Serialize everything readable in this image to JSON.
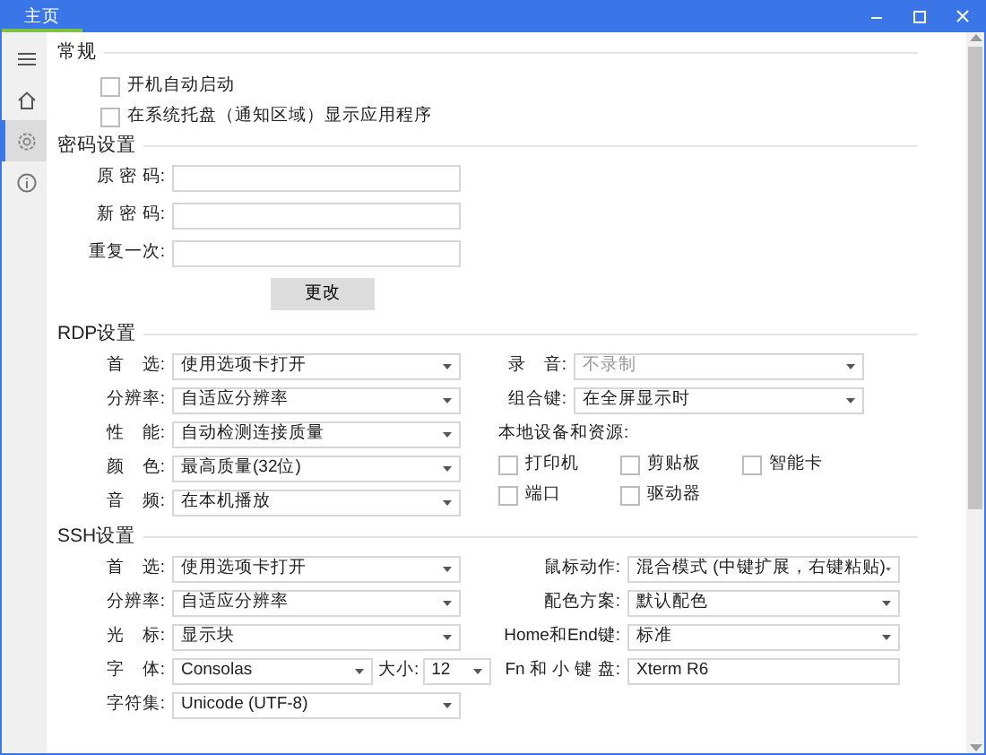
{
  "window": {
    "tab": "主页"
  },
  "sidebar": {
    "items": [
      {
        "kind": "menu",
        "selected": false
      },
      {
        "kind": "home",
        "selected": false
      },
      {
        "kind": "settings",
        "selected": true
      },
      {
        "kind": "info",
        "selected": false
      }
    ]
  },
  "general": {
    "title": "常规",
    "options": [
      {
        "label": "开机自动启动",
        "checked": false
      },
      {
        "label": "在系统托盘（通知区域）显示应用程序",
        "checked": false
      }
    ]
  },
  "password": {
    "title": "密码设置",
    "fields": [
      {
        "label": "原 密 码:"
      },
      {
        "label": "新 密 码:"
      },
      {
        "label": "重复一次:"
      }
    ],
    "button": "更改"
  },
  "rdp": {
    "title": "RDP设置",
    "left": [
      {
        "kind": "dropdown",
        "label": "首　选:",
        "value": "使用选项卡打开",
        "disabled": false
      },
      {
        "kind": "dropdown",
        "label": "分辨率:",
        "value": "自适应分辨率",
        "disabled": false
      },
      {
        "kind": "dropdown",
        "label": "性　能:",
        "value": "自动检测连接质量",
        "disabled": false
      },
      {
        "kind": "dropdown",
        "label": "颜　色:",
        "value": "最高质量(32位)",
        "disabled": false
      },
      {
        "kind": "dropdown",
        "label": "音　频:",
        "value": "在本机播放",
        "disabled": false
      }
    ],
    "right": [
      {
        "kind": "dropdown",
        "label": "录　音:",
        "value": "不录制",
        "disabled": true
      },
      {
        "kind": "dropdown",
        "label": "组合键:",
        "value": "在全屏显示时",
        "disabled": false
      }
    ],
    "resources_label": "本地设备和资源:",
    "resources": [
      {
        "label": "打印机",
        "checked": false
      },
      {
        "label": "剪贴板",
        "checked": false
      },
      {
        "label": "智能卡",
        "checked": false
      },
      {
        "label": "端口",
        "checked": false
      },
      {
        "label": "驱动器",
        "checked": false
      }
    ]
  },
  "ssh": {
    "title": "SSH设置",
    "left": [
      {
        "kind": "dropdown",
        "label": "首　选:",
        "value": "使用选项卡打开",
        "disabled": false
      },
      {
        "kind": "dropdown",
        "label": "分辨率:",
        "value": "自适应分辨率",
        "disabled": false
      },
      {
        "kind": "dropdown",
        "label": "光　标:",
        "value": "显示块",
        "disabled": false
      },
      {
        "kind": "font",
        "label": "字　体:",
        "value": "Consolas",
        "size_label": "大小:",
        "size": "12",
        "disabled": false
      },
      {
        "kind": "dropdown",
        "label": "字符集:",
        "value": "Unicode (UTF-8)",
        "disabled": false
      }
    ],
    "right": [
      {
        "kind": "dropdown",
        "label": "鼠标动作:",
        "value": "混合模式 (中键扩展，右键粘贴)",
        "disabled": false
      },
      {
        "kind": "dropdown",
        "label": "配色方案:",
        "value": "默认配色",
        "disabled": false
      },
      {
        "kind": "dropdown",
        "label": "Home和End键:",
        "value": "标准",
        "disabled": false
      },
      {
        "kind": "input",
        "label": "Fn 和 小 键 盘:",
        "value": "Xterm R6",
        "disabled": false
      }
    ]
  }
}
